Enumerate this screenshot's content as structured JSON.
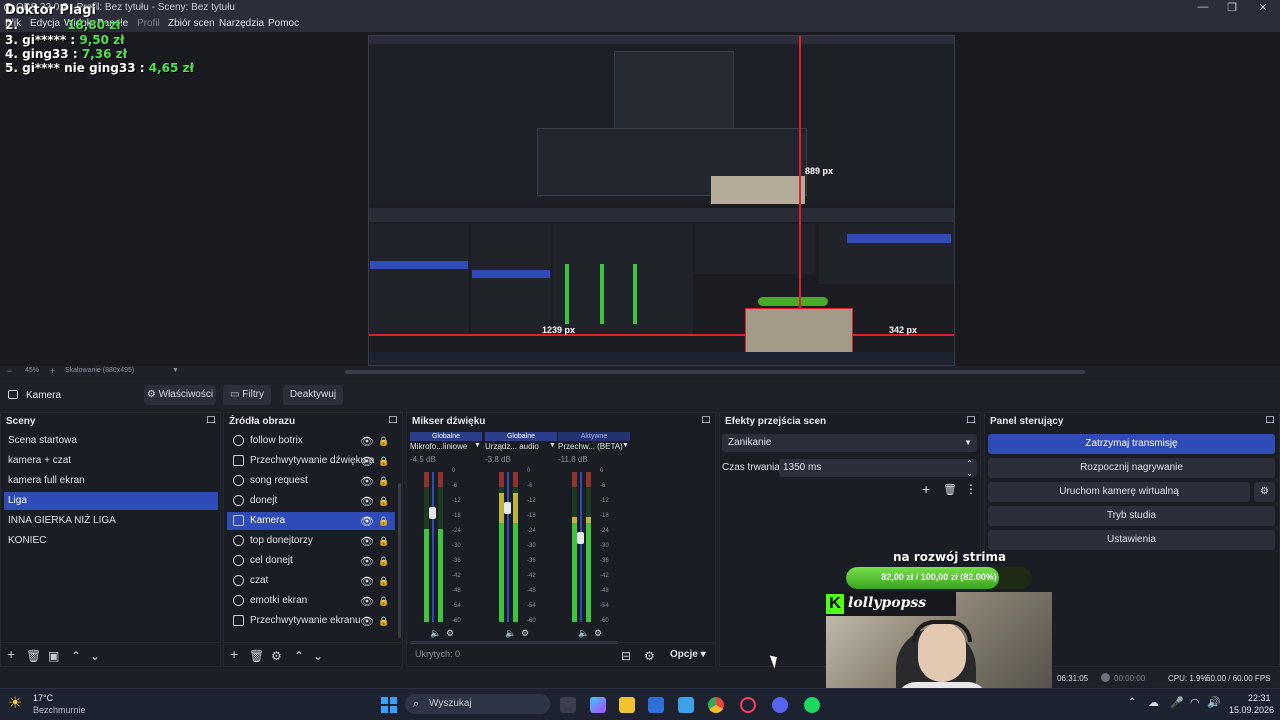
{
  "window": {
    "title": "OBS 32.0.2 - Profil: Bez tytułu - Sceny: Bez tytułu"
  },
  "menu": [
    "Plik",
    "Edycja",
    "Widok",
    "Panele",
    "Profil",
    "Zbiór scen",
    "Narzędzia",
    "Pomoc"
  ],
  "leaderboard": {
    "header": "Doktor Plagi",
    "rows": [
      {
        "rank": "2.",
        "name": "",
        "amount": "18,80 zł"
      },
      {
        "rank": "3.",
        "name": "gi*****",
        "amount": "9,50 zł"
      },
      {
        "rank": "4.",
        "name": "ging33",
        "amount": "7,36 zł"
      },
      {
        "rank": "5.",
        "name": "gi**** nie ging33",
        "amount": "4,65 zł"
      }
    ]
  },
  "preview": {
    "width_label": "889 px",
    "left_label": "1239 px",
    "right_label": "342 px",
    "zoom": "45%",
    "scaling": "Skalowanie (880x495)"
  },
  "source_toolbar": {
    "source_name": "Kamera",
    "properties": "Właściwości",
    "filters": "Filtry",
    "deactivate": "Deaktywuj"
  },
  "scenes": {
    "title": "Sceny",
    "items": [
      "Scena startowa",
      "kamera + czat",
      "kamera full ekran",
      "Liga",
      "INNA GIERKA NIŻ LIGA",
      "KONIEC"
    ],
    "selected": 3
  },
  "sources": {
    "title": "Źródła obrazu",
    "items": [
      "follow botrix",
      "Przechwytywanie dźwięku a",
      "song request",
      "donejt",
      "Kamera",
      "top donejtorzy",
      "cel donejt",
      "czat",
      "emotki ekran",
      "Przechwytywanie ekranu"
    ],
    "selected": 4
  },
  "mixer": {
    "title": "Mikser dźwięku",
    "channels": [
      {
        "badge": "Globalne",
        "name": "Mikrofo...liniowe",
        "db": "-4.5 dB",
        "level": 0.62,
        "fader": 0.77
      },
      {
        "badge": "Globalne",
        "name": "Urządz... audio",
        "db": "-3.8 dB",
        "level": 0.93,
        "fader": 0.8
      },
      {
        "badge": "Aktywne",
        "name": "Przechw... (BETA)",
        "db": "-11.8 dB",
        "level": 0.7,
        "fader": 0.6
      }
    ],
    "ticks": [
      "0",
      "-6",
      "-12",
      "-18",
      "-24",
      "-30",
      "-36",
      "-42",
      "-48",
      "-54",
      "-60"
    ],
    "hidden": "Ukrytych: 0",
    "options": "Opcje"
  },
  "transitions": {
    "title": "Efekty przejścia scen",
    "selected": "Zanikanie",
    "duration_label": "Czas trwania",
    "duration_value": "1350 ms"
  },
  "controls": {
    "title": "Panel sterujący",
    "buttons": [
      "Zatrzymaj transmisję",
      "Rozpocznij nagrywanie",
      "Uruchom kamerę wirtualną",
      "Tryb studia",
      "Ustawienia"
    ]
  },
  "overlay": {
    "goal_title": "na rozwój strima",
    "goal_text": "82,00 zł / 100,00 zł (82.00%)",
    "goal_fraction": 0.82,
    "kick_name": "lollypopss"
  },
  "status": {
    "time": "06:31:05",
    "rec_time": "00:00:00",
    "cpu": "CPU: 1.9%",
    "fps": "60.00 / 60.00 FPS"
  },
  "taskbar": {
    "weather_temp": "17°C",
    "weather_desc": "Bezchmurnie",
    "search": "Wyszukaj",
    "clock_time": "22:31",
    "clock_date": "15.09.2026"
  },
  "colors": {
    "accent": "#2f4bb8",
    "kick_green": "#53fc18",
    "goal_green": "#4fe34f"
  }
}
